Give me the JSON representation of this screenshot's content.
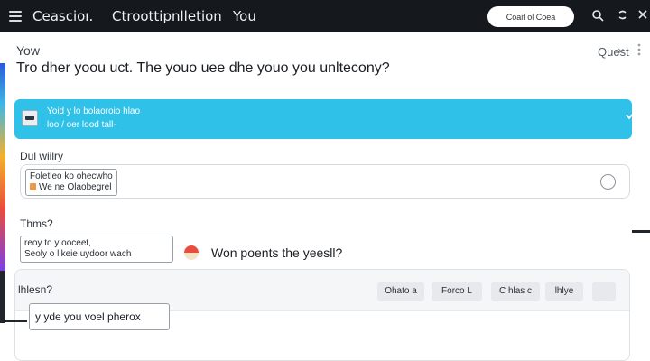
{
  "header": {
    "app_title": "Ceascioı.",
    "app_subtitle": "Ctroottipnlletion",
    "you_label": "You",
    "top_button_label": "Coait ol Coea",
    "icons": [
      "menu-icon",
      "search-icon",
      "settings-icon",
      "close-icon"
    ]
  },
  "page": {
    "label": "Yow",
    "quest_label": "Quest",
    "close_glyph": "×",
    "heading": "Tro dher yoou uct. The youo uee dhe youo you unltecony?"
  },
  "card": {
    "line1": "Yoid y lo bolaoroio hlao",
    "line2": "loo / oer lood tall-"
  },
  "section1": {
    "label": "Dul wiilry",
    "tag_line1": "Foletleo ko ohecwho",
    "tag_line2": "We ne Olaobegrel"
  },
  "section2": {
    "label": "Thms?",
    "tag_line1": "reoy to y ooceet,",
    "tag_line2": "Seoly o llkeie uydoor wach",
    "question": "Won poents the yeesll?"
  },
  "section3": {
    "label": "lhlesn?",
    "chips": [
      "Ohato a",
      "Forco L",
      "C hlas c",
      "lhlye",
      ""
    ],
    "hint_text": "y yde you voel pherox"
  },
  "colors": {
    "topbar": "#15181d",
    "accent_card": "#2fc1e8",
    "chip_bg": "#e7e9ec",
    "border": "#d6dae0"
  }
}
